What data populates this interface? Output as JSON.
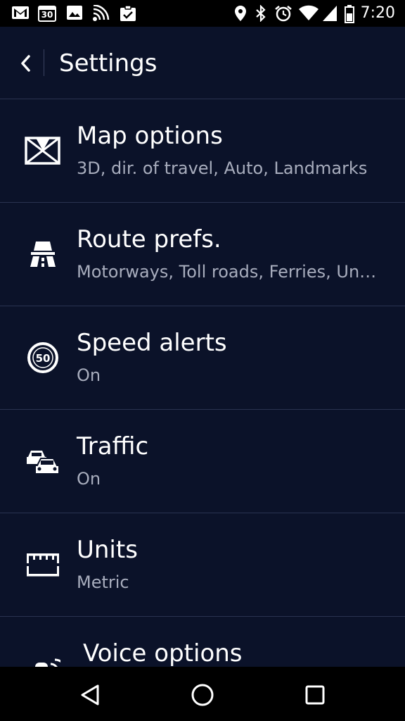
{
  "status_bar": {
    "time": "7:20",
    "left_icons": [
      "gmail-icon",
      "calendar-icon",
      "image-icon",
      "signal-stream-icon",
      "task-icon"
    ],
    "right_icons": [
      "location-icon",
      "bluetooth-icon",
      "alarm-icon",
      "wifi-icon",
      "cell-signal-icon",
      "battery-icon"
    ],
    "calendar_day": "30"
  },
  "header": {
    "title": "Settings"
  },
  "items": [
    {
      "title": "Map options",
      "subtitle": "3D, dir. of travel, Auto, Landmarks",
      "icon": "map-icon"
    },
    {
      "title": "Route prefs.",
      "subtitle": "Motorways, Toll roads, Ferries, Unpaved roads",
      "icon": "motorway-icon"
    },
    {
      "title": "Speed alerts",
      "subtitle": "On",
      "icon": "speed-limit-icon",
      "icon_text": "50"
    },
    {
      "title": "Traffic",
      "subtitle": "On",
      "icon": "traffic-icon"
    },
    {
      "title": "Units",
      "subtitle": "Metric",
      "icon": "ruler-icon"
    },
    {
      "title": "Voice options",
      "subtitle": "",
      "icon": "voice-icon"
    }
  ],
  "colors": {
    "background": "#0b1229",
    "divider": "#2a3350",
    "subtitle": "#a8adbd",
    "bars": "#000000"
  }
}
